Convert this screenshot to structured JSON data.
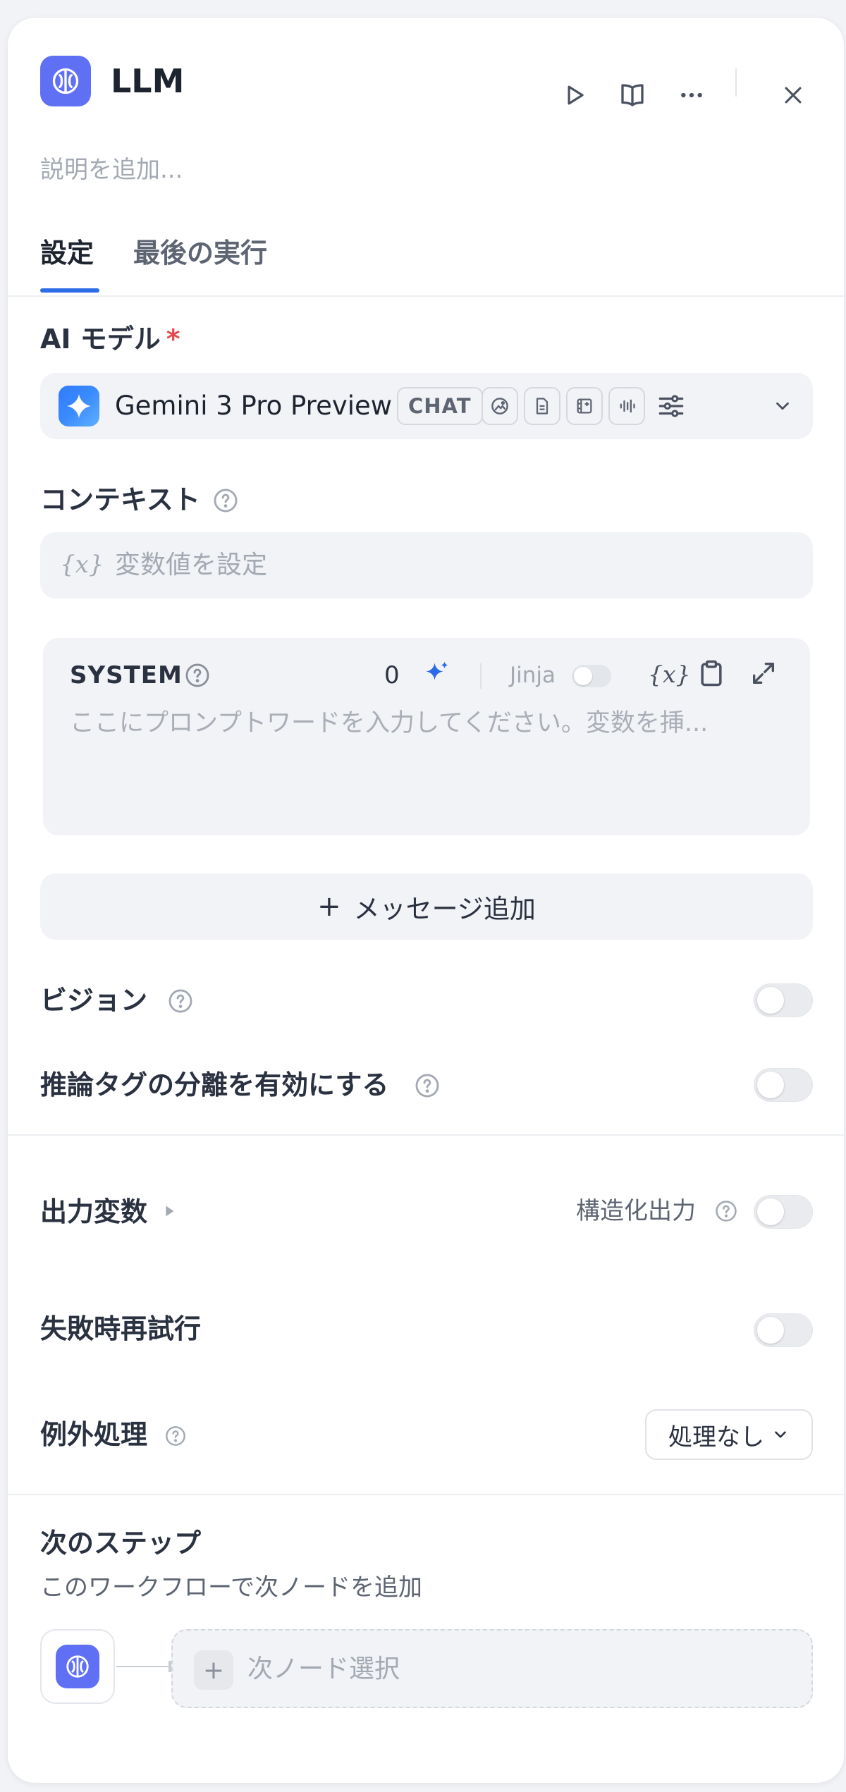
{
  "header": {
    "title": "LLM",
    "description_placeholder": "説明を追加..."
  },
  "tabs": [
    {
      "label": "設定",
      "active": true
    },
    {
      "label": "最後の実行",
      "active": false
    }
  ],
  "model": {
    "section_label": "AI モデル",
    "required_mark": "*",
    "name": "Gemini 3 Pro Preview",
    "mode_chip": "CHAT",
    "capability_icons": [
      "vision-icon",
      "document-icon",
      "video-icon",
      "audio-icon"
    ]
  },
  "context": {
    "section_label": "コンテキスト",
    "variable_icon": "{x}",
    "placeholder": "変数値を設定"
  },
  "system_prompt": {
    "label": "SYSTEM",
    "token_count": "0",
    "jinja_label": "Jinja",
    "variable_icon": "{x}",
    "placeholder": "ここにプロンプトワードを入力してください。変数を挿..."
  },
  "add_message": {
    "plus": "+",
    "label": "メッセージ追加"
  },
  "vision": {
    "label": "ビジョン"
  },
  "reasoning_tag": {
    "label": "推論タグの分離を有効にする"
  },
  "output_vars": {
    "label": "出力変数",
    "structured_label": "構造化出力"
  },
  "retry": {
    "label": "失敗時再試行"
  },
  "exception": {
    "label": "例外処理",
    "selected": "処理なし"
  },
  "next_step": {
    "title": "次のステップ",
    "subtitle": "このワークフローで次ノードを追加",
    "plus": "+",
    "select_placeholder": "次ノード選択"
  },
  "colors": {
    "accent": "#2d6ce8",
    "node_icon": "#6070f5",
    "required": "#e5484d"
  }
}
